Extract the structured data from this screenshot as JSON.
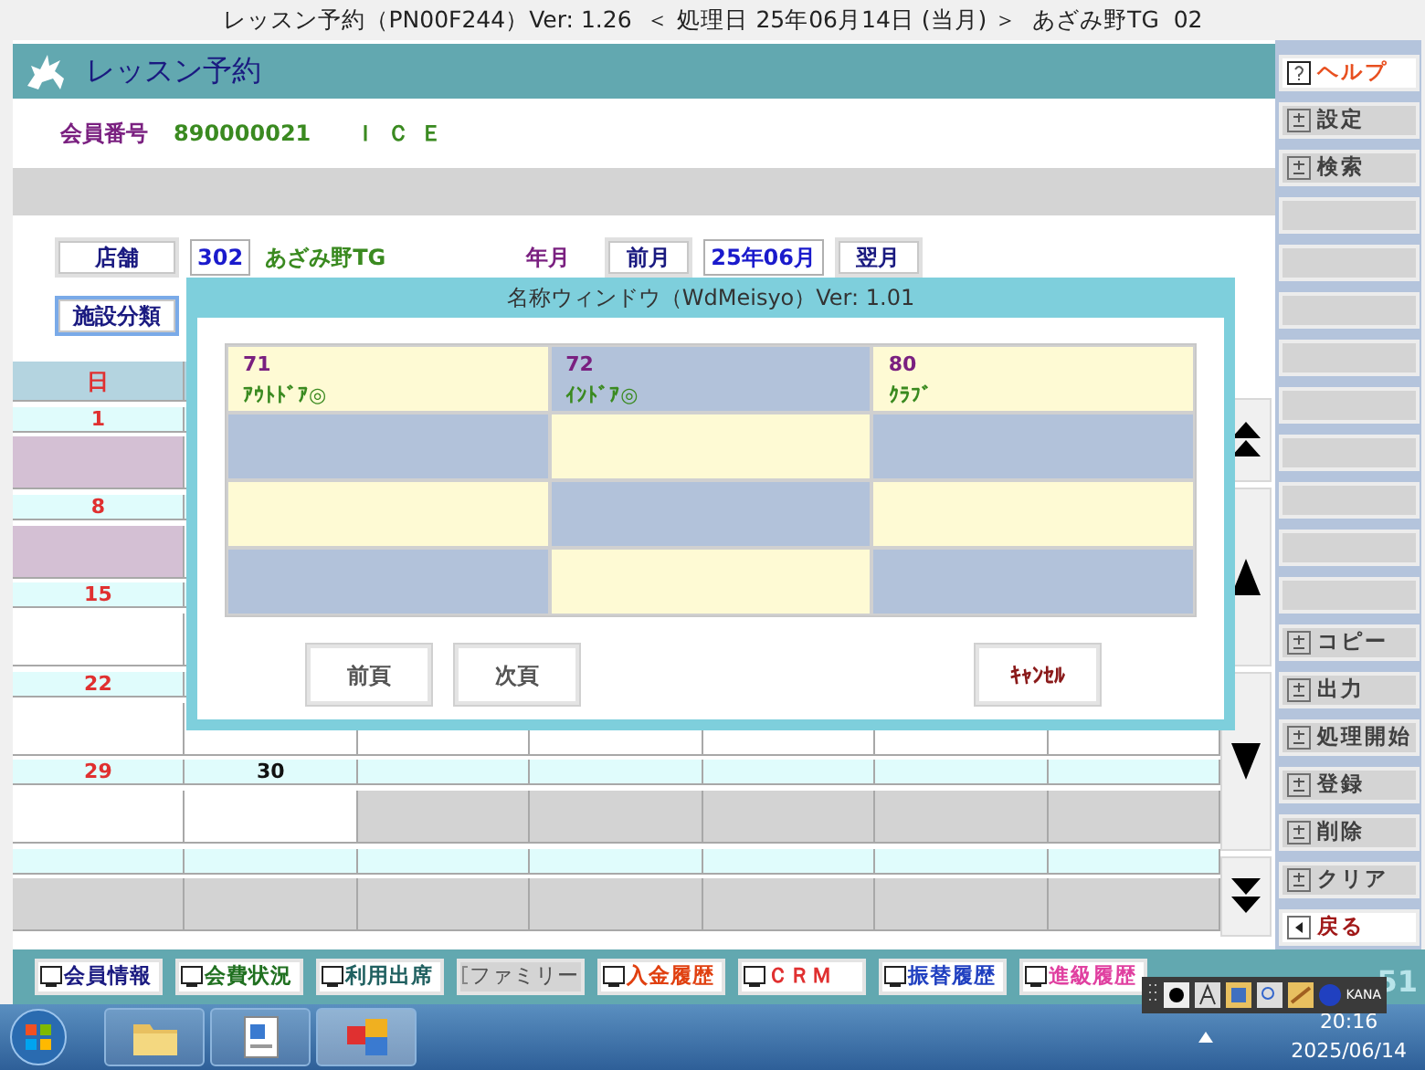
{
  "window": {
    "title": "レッスン予約（PN00F244）Ver: 1.26  ＜ 処理日 25年06月14日 (当月) ＞  あざみ野TG  02"
  },
  "header": {
    "title": "レッスン予約"
  },
  "member": {
    "label": "会員番号",
    "number": "890000021",
    "name": "ＩＣＥ"
  },
  "store": {
    "button": "店舗",
    "code": "302",
    "name": "あざみ野TG",
    "period_label": "年月",
    "prev": "前月",
    "period": "25年06月",
    "next": "翌月"
  },
  "facility": {
    "button": "施設分類",
    "focused": true
  },
  "calendar": {
    "columns": [
      "日"
    ],
    "weeks": [
      {
        "kind": "week",
        "days": [
          "1"
        ],
        "highlighted": true
      },
      {
        "kind": "week",
        "days": [
          "8"
        ],
        "highlighted": true
      },
      {
        "kind": "week",
        "days": [
          "15"
        ],
        "highlighted": false
      },
      {
        "kind": "week",
        "days": [
          "22"
        ],
        "highlighted": false
      },
      {
        "kind": "week",
        "days": [
          "29",
          "30"
        ],
        "highlighted": false
      },
      {
        "kind": "empty"
      }
    ]
  },
  "dialog": {
    "title": "名称ウィンドウ（WdMeisyo）Ver: 1.01",
    "cells": [
      {
        "code": "71",
        "name": "ｱｳﾄﾄﾞｱ◎"
      },
      {
        "code": "72",
        "name": "ｲﾝﾄﾞｱ◎"
      },
      {
        "code": "80",
        "name": "ｸﾗﾌﾞ"
      },
      {
        "empty": true
      },
      {
        "empty": true
      },
      {
        "empty": true
      },
      {
        "empty": true
      },
      {
        "empty": true
      },
      {
        "empty": true
      },
      {
        "empty": true
      },
      {
        "empty": true
      },
      {
        "empty": true
      }
    ],
    "prev": "前頁",
    "next": "次頁",
    "cancel": "ｷｬﾝｾﾙ"
  },
  "sidebar": {
    "buttons": [
      {
        "kind": "help",
        "label": "ヘルプ"
      },
      {
        "kind": "action",
        "label": "設定"
      },
      {
        "kind": "action",
        "label": "検索"
      },
      {
        "kind": "blank"
      },
      {
        "kind": "blank"
      },
      {
        "kind": "blank"
      },
      {
        "kind": "blank"
      },
      {
        "kind": "blank"
      },
      {
        "kind": "blank"
      },
      {
        "kind": "blank"
      },
      {
        "kind": "blank"
      },
      {
        "kind": "blank"
      },
      {
        "kind": "action",
        "label": "コピー"
      },
      {
        "kind": "action",
        "label": "出力"
      },
      {
        "kind": "action",
        "label": "処理開始"
      },
      {
        "kind": "action",
        "label": "登録"
      },
      {
        "kind": "action",
        "label": "削除"
      },
      {
        "kind": "action",
        "label": "クリア"
      },
      {
        "kind": "back",
        "label": "戻る"
      }
    ]
  },
  "bottom_bar": {
    "buttons": [
      {
        "label": "会員情報",
        "color": "#1a1a80",
        "disabled": false
      },
      {
        "label": "会費状況",
        "color": "#207020",
        "disabled": false
      },
      {
        "label": "利用出席",
        "color": "#206060",
        "disabled": false
      },
      {
        "label": "ファミリー",
        "color": "#505050",
        "disabled": true
      },
      {
        "label": "入金履歴",
        "color": "#e04010",
        "disabled": false
      },
      {
        "label": "ＣＲＭ",
        "color": "#e03030",
        "disabled": false
      },
      {
        "label": "振替履歴",
        "color": "#2040c0",
        "disabled": false
      },
      {
        "label": "進級履歴",
        "color": "#e040a0",
        "disabled": false
      }
    ],
    "brand": "51"
  },
  "ime_bar": {
    "mode": "KANA"
  },
  "taskbar": {
    "time": "20:16",
    "date": "2025/06/14"
  }
}
